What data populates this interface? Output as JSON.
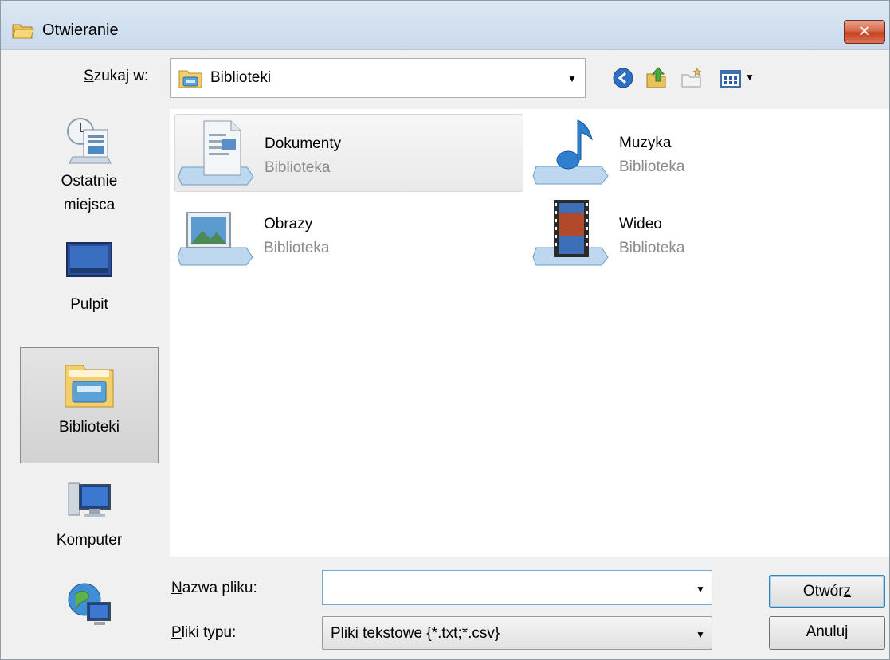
{
  "window": {
    "title": "Otwieranie",
    "close_label": "✕"
  },
  "lookin": {
    "label_prefix": "S",
    "label_rest": "zukaj w:",
    "value": "Biblioteki"
  },
  "toolbar": {
    "icons": [
      "back-icon",
      "up-folder-icon",
      "new-folder-icon",
      "view-menu-icon"
    ]
  },
  "places": [
    {
      "id": "recent",
      "label_line1": "Ostatnie",
      "label_line2": "miejsca"
    },
    {
      "id": "desktop",
      "label_line1": "Pulpit"
    },
    {
      "id": "libraries",
      "label_line1": "Biblioteki",
      "selected": true
    },
    {
      "id": "computer",
      "label_line1": "Komputer"
    },
    {
      "id": "network",
      "label_line1": ""
    }
  ],
  "libraries": [
    {
      "name": "Dokumenty",
      "type": "Biblioteka",
      "icon": "documents-library-icon",
      "selected": true
    },
    {
      "name": "Muzyka",
      "type": "Biblioteka",
      "icon": "music-library-icon"
    },
    {
      "name": "Obrazy",
      "type": "Biblioteka",
      "icon": "pictures-library-icon"
    },
    {
      "name": "Wideo",
      "type": "Biblioteka",
      "icon": "video-library-icon"
    }
  ],
  "bottom": {
    "filename_label_prefix": "N",
    "filename_label_rest": "azwa pliku:",
    "filename_value": "",
    "filetype_label_prefix": "P",
    "filetype_label_rest": "liki typu:",
    "filetype_value": "Pliki tekstowe {*.txt;*.csv}",
    "open_label_main": "Otwór",
    "open_label_underlined": "z",
    "cancel_label": "Anuluj"
  },
  "colors": {
    "titlebar": "#c9daec",
    "close_button": "#c4431f",
    "default_button_border": "#3c7fb1",
    "secondary_text": "#8a8a8a"
  }
}
